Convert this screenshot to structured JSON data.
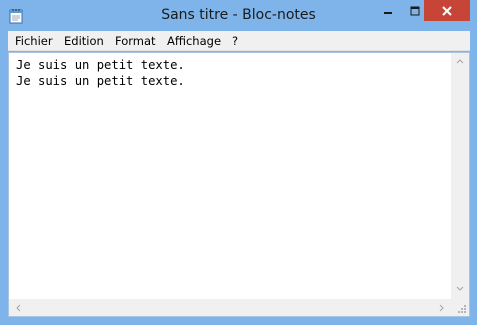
{
  "window": {
    "title": "Sans titre - Bloc-notes",
    "accent_color": "#7eb4ea",
    "close_color": "#c74537",
    "icons": {
      "app": "notepad-icon",
      "minimize": "minimize-icon",
      "maximize": "maximize-icon",
      "close": "close-icon"
    }
  },
  "menu": {
    "items": [
      "Fichier",
      "Edition",
      "Format",
      "Affichage",
      "?"
    ]
  },
  "editor": {
    "lines": [
      "Je suis un petit texte.",
      "Je suis un petit texte."
    ]
  },
  "scrollbars": {
    "icons": {
      "up": "scroll-up-arrow-icon",
      "down": "scroll-down-arrow-icon",
      "left": "scroll-left-arrow-icon",
      "right": "scroll-right-arrow-icon",
      "grip": "resize-grip-icon"
    }
  }
}
